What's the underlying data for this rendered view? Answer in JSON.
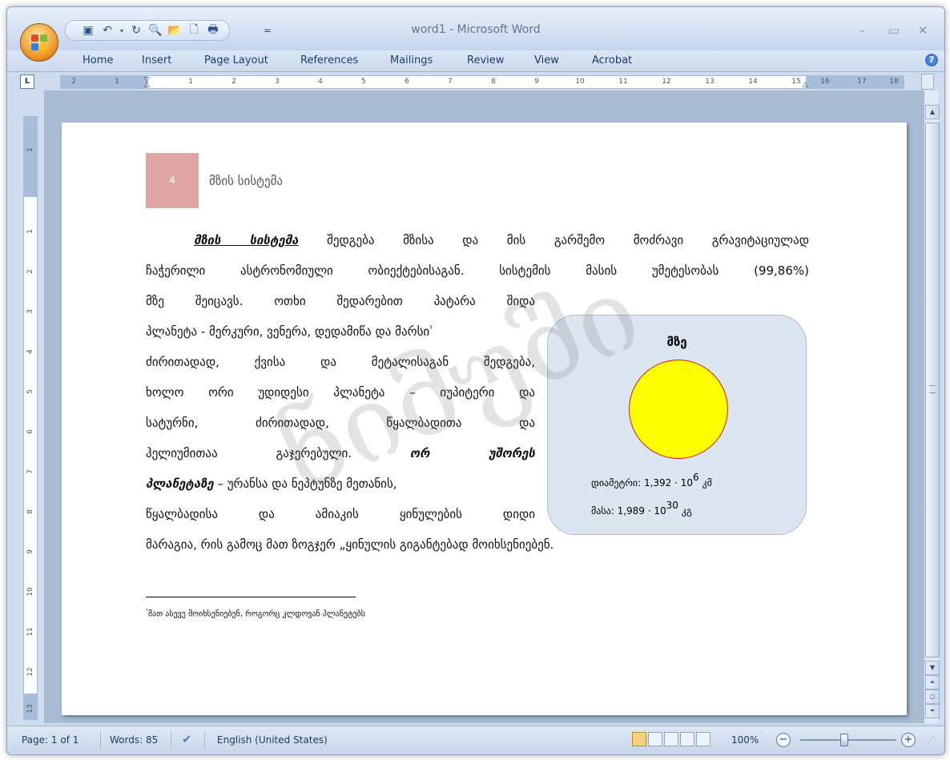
{
  "window": {
    "title": "word1 - Microsoft Word"
  },
  "quick_access": {
    "icons": [
      "save-icon",
      "undo-icon",
      "undo-dropdown-icon",
      "redo-icon",
      "print-preview-icon",
      "open-folder-icon",
      "new-document-icon",
      "print-icon"
    ],
    "more": "="
  },
  "window_controls": {
    "minimize": "–",
    "maximize": "▭",
    "close": "✕"
  },
  "ribbon_tabs": [
    "Home",
    "Insert",
    "Page Layout",
    "References",
    "Mailings",
    "Review",
    "View",
    "Acrobat"
  ],
  "help": "?",
  "tab_selector": "L",
  "ruler": {
    "h_labels": [
      "2",
      "1",
      "1",
      "2",
      "3",
      "4",
      "5",
      "6",
      "7",
      "8",
      "9",
      "10",
      "11",
      "12",
      "13",
      "14",
      "15",
      "16",
      "17",
      "18"
    ],
    "v_labels": [
      "1",
      "1",
      "2",
      "3",
      "4",
      "5",
      "6",
      "7",
      "8",
      "9",
      "10",
      "11",
      "12",
      "13"
    ]
  },
  "document": {
    "section_number": "4",
    "section_title": "მზის სისტემა",
    "term": "მზის სისტემა",
    "lines": [
      "შედგება მზისა და მის გარშემო მოძრავი გრავიტაციულად",
      "ჩაჭერილი ასტრონომიული ობიექტებისაგან. სისტემის მასის უმეტესობას (99,86%)",
      "მზე შეიცავს. ოთხი შედარებით პატარა შიდა",
      "პლანეტა - მერკური, ვენერა, დედამიწა და მარსი",
      "ძირითადად, ქვისა და მეტალისაგან შედგება,",
      "ხოლო ორი უდიდესი პლანეტა – იუპიტერი და",
      "სატურნი, ძირითადად, წყალბადითა და",
      "ჰელიუმითაა გაჯერებული.",
      "ორ უშორეს",
      "პლანეტაზე",
      " – ურანსა და ნეპტუნზე მეთანის,",
      "წყალბადისა და ამიაკის ყინულების დიდი",
      "მარაგია, რის გამოც მათ ზოგჯერ „ყინულის გიგანტებად მოიხსენიებენ."
    ],
    "footnote_mark": "¹",
    "footnote": "მათ ასევე მოიხსენიებენ, როგორც კლდოვან პლანეტებს",
    "watermark": "ნიმუში"
  },
  "sun_box": {
    "title": "მზე",
    "diameter_label": "დიამეტრი: 1,392 · 10",
    "diameter_exp": "6",
    "diameter_unit": "კმ",
    "mass_label": "მასა: 1,989 · 10",
    "mass_exp": "30",
    "mass_unit": "კგ",
    "fill_color": "#ffff00",
    "stroke_color": "#d11c1c"
  },
  "status": {
    "page": "Page: 1 of 1",
    "words": "Words: 85",
    "language": "English (United States)",
    "zoom": "100%",
    "zoom_out": "−",
    "zoom_in": "+"
  },
  "colors": {
    "ribbon_bg": "#cfdcee",
    "badge_bg": "#dfa5a4",
    "workspace_bg": "#a9bad3"
  }
}
